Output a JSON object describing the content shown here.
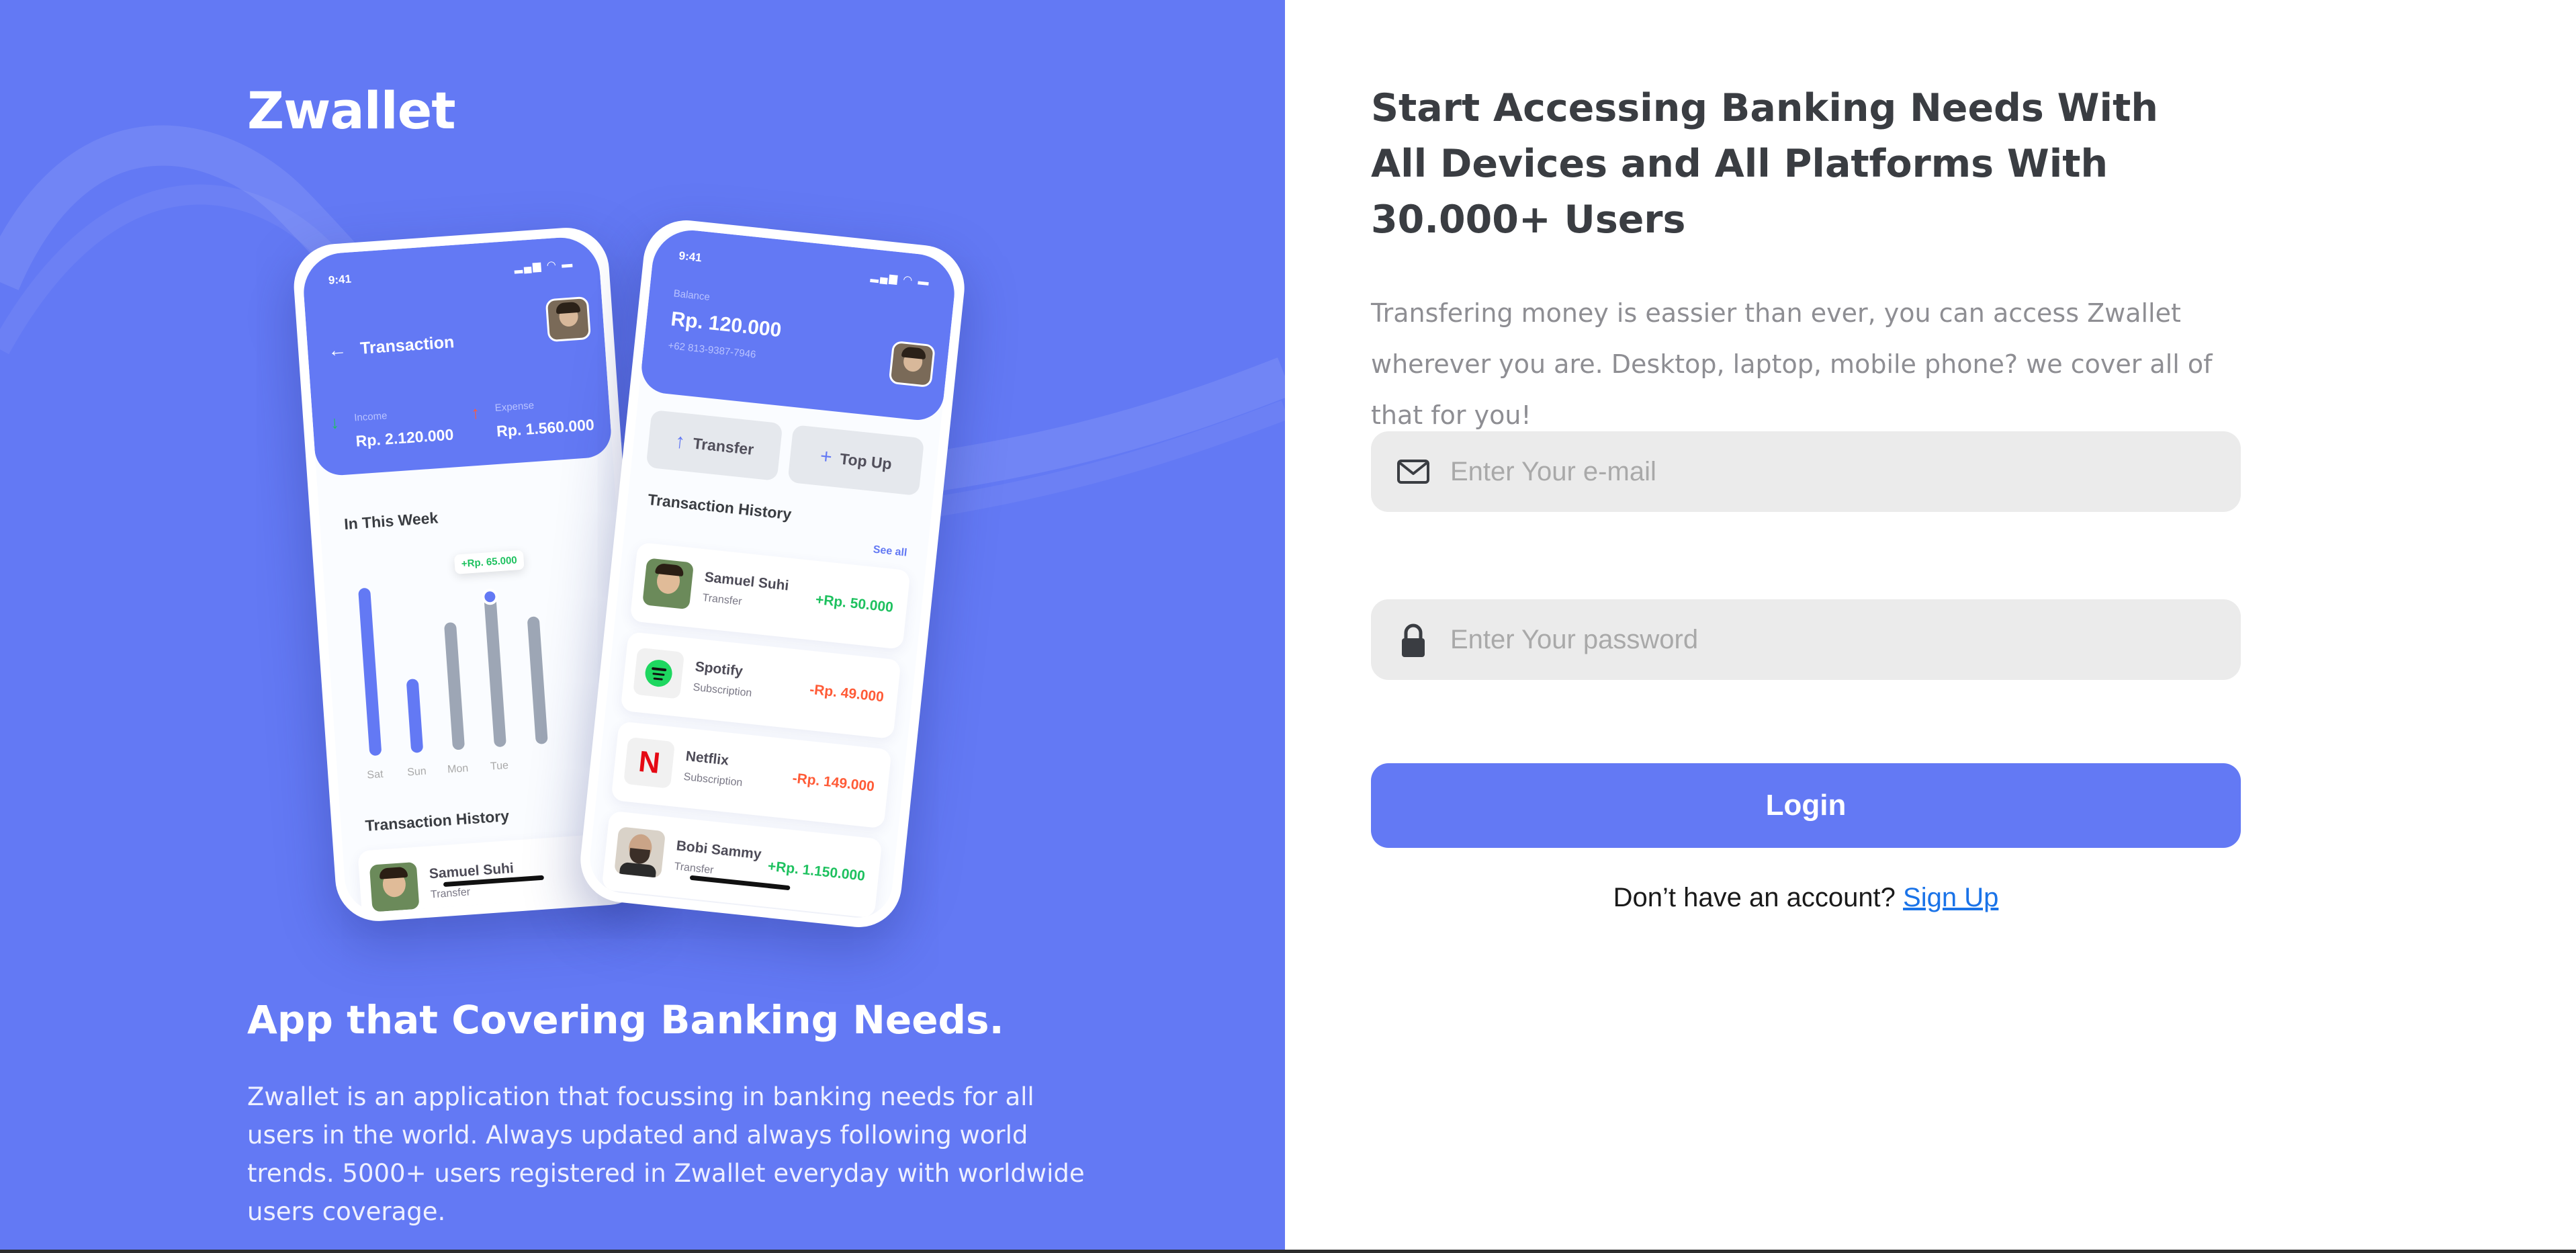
{
  "brand": {
    "name": "Zwallet"
  },
  "left": {
    "heading": "App that Covering Banking Needs.",
    "description": "Zwallet is an application that focussing in banking needs for all users in the world. Always updated and always following world trends. 5000+ users registered in Zwallet everyday with worldwide users coverage."
  },
  "phone_back": {
    "time": "9:41",
    "title": "Transaction",
    "income_label": "Income",
    "income_value": "Rp. 2.120.000",
    "expense_label": "Expense",
    "expense_value": "Rp. 1.560.000",
    "week_label": "In This Week",
    "tooltip": "+Rp. 65.000",
    "days": [
      "Sat",
      "Sun",
      "Mon",
      "Tue"
    ],
    "history_label": "Transaction History",
    "history_item": {
      "name": "Samuel Suhi",
      "type": "Transfer"
    }
  },
  "phone_front": {
    "time": "9:41",
    "balance_label": "Balance",
    "balance_value": "Rp. 120.000",
    "phone_number": "+62 813-9387-7946",
    "transfer_label": "Transfer",
    "topup_label": "Top Up",
    "history_label": "Transaction History",
    "see_all": "See all",
    "transactions": [
      {
        "name": "Samuel Suhi",
        "type": "Transfer",
        "amount": "+Rp. 50.000"
      },
      {
        "name": "Spotify",
        "type": "Subscription",
        "amount": "-Rp. 49.000"
      },
      {
        "name": "Netflix",
        "type": "Subscription",
        "amount": "-Rp. 149.000"
      },
      {
        "name": "Bobi Sammy",
        "type": "Transfer",
        "amount": "+Rp. 1.150.000"
      }
    ]
  },
  "right": {
    "heading": "Start Accessing Banking Needs With All Devices and All Platforms With 30.000+ Users",
    "description": "Transfering money is eassier than ever, you can access Zwallet wherever you are. Desktop, laptop, mobile phone? we cover all of that for you!",
    "email_placeholder": "Enter Your e-mail",
    "password_placeholder": "Enter Your password",
    "login_label": "Login",
    "signup_prompt": "Don’t have an account?",
    "signup_link": "Sign Up"
  },
  "colors": {
    "primary": "#6379F4",
    "income": "#1EC15F",
    "expense": "#FF5B37",
    "field_bg": "#EBEBEB"
  },
  "icons": {
    "email": "mail-icon",
    "password": "lock-icon",
    "transfer": "arrow-up-icon",
    "topup": "plus-icon"
  }
}
